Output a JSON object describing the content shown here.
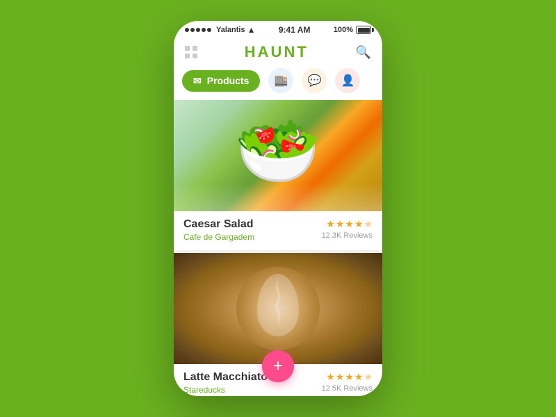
{
  "statusBar": {
    "carrier": "Yalantis",
    "time": "9:41 AM",
    "battery": "100%"
  },
  "header": {
    "title": "HAUNT",
    "searchLabel": "search"
  },
  "nav": {
    "activeTab": {
      "label": "Products",
      "icon": "🛍"
    },
    "tabs": [
      {
        "id": "products",
        "label": "Products",
        "icon": "🛍",
        "active": true
      },
      {
        "id": "store",
        "label": "Store",
        "icon": "🏬",
        "active": false
      },
      {
        "id": "chat",
        "label": "Chat",
        "icon": "💬",
        "active": false
      },
      {
        "id": "profile",
        "label": "Profile",
        "icon": "👤",
        "active": false
      }
    ]
  },
  "products": [
    {
      "id": 1,
      "name": "Caesar Salad",
      "restaurant": "Cafe de Gargadem",
      "rating": 4.5,
      "reviews": "12.3K Reviews",
      "imageType": "salad"
    },
    {
      "id": 2,
      "name": "Latte Macchiato",
      "restaurant": "Stareducks",
      "rating": 4.0,
      "reviews": "12.5K Reviews",
      "imageType": "latte"
    }
  ],
  "fab": {
    "label": "+"
  }
}
